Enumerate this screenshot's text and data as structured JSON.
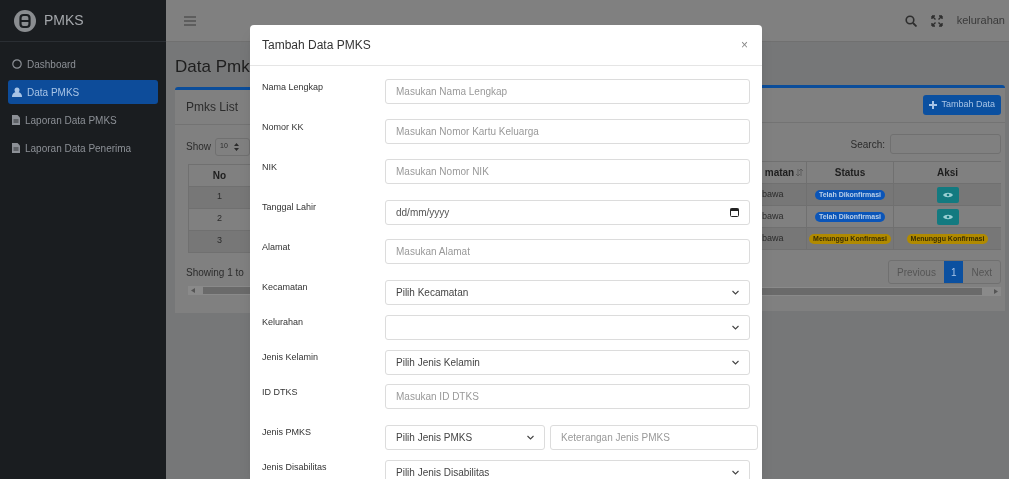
{
  "app": {
    "name": "PMKS"
  },
  "sidebar": {
    "items": [
      {
        "label": "Dashboard",
        "kind": "circle",
        "selected": false
      },
      {
        "label": "Data PMKS",
        "kind": "user",
        "selected": true
      },
      {
        "label": "Laporan Data PMKS",
        "kind": "file",
        "selected": false
      },
      {
        "label": "Laporan Data Penerima",
        "kind": "file",
        "selected": false
      }
    ]
  },
  "navbar": {
    "user": "kelurahan"
  },
  "page": {
    "title": "Data Pmk"
  },
  "card": {
    "title": "Pmks List",
    "add_button": "Tambah Data",
    "show_label": "Show",
    "page_size": "10",
    "search_label": "Search:"
  },
  "table": {
    "columns": [
      "No",
      "matan",
      "Status",
      "Aksi"
    ],
    "rows": [
      {
        "no": "1",
        "column_2": "bawa",
        "status": {
          "label": "Telah Dikonfirmasi",
          "kind": "confirmed"
        },
        "action": {
          "kind": "view"
        }
      },
      {
        "no": "2",
        "column_2": "bawa",
        "status": {
          "label": "Telah Dikonfirmasi",
          "kind": "confirmed"
        },
        "action": {
          "kind": "view"
        }
      },
      {
        "no": "3",
        "column_2": "bawa",
        "status": {
          "label": "Menunggu Konfirmasi",
          "kind": "waiting"
        },
        "action": {
          "kind": "badge",
          "label": "Menunggu Konfirmasi"
        }
      }
    ]
  },
  "footer": {
    "info": "Showing 1 to",
    "pagination": [
      {
        "label": "Previous",
        "selected": false
      },
      {
        "label": "1",
        "selected": true
      },
      {
        "label": "Next",
        "selected": false
      }
    ]
  },
  "modal": {
    "title": "Tambah Data PMKS",
    "close": "×",
    "fields": [
      {
        "label": "Nama Lengkap",
        "kind": "text",
        "placeholder": "Masukan Nama Lengkap"
      },
      {
        "label": "Nomor KK",
        "kind": "text",
        "placeholder": "Masukan Nomor Kartu Keluarga"
      },
      {
        "label": "NIK",
        "kind": "text",
        "placeholder": "Masukan Nomor NIK"
      },
      {
        "label": "Tanggal Lahir",
        "kind": "date",
        "placeholder": "dd/mm/yyyy"
      },
      {
        "label": "Alamat",
        "kind": "text",
        "placeholder": "Masukan Alamat"
      },
      {
        "label": "Kecamatan",
        "kind": "select",
        "value": "Pilih Kecamatan"
      },
      {
        "label": "Kelurahan",
        "kind": "select"
      },
      {
        "label": "Jenis Kelamin",
        "kind": "select",
        "value": "Pilih Jenis Kelamin"
      },
      {
        "label": "ID DTKS",
        "kind": "text",
        "placeholder": "Masukan ID DTKS"
      },
      {
        "label": "Jenis PMKS",
        "kind": "select_text",
        "value": "Pilih Jenis PMKS",
        "placeholder": "Keterangan Jenis PMKS"
      },
      {
        "label": "Jenis Disabilitas",
        "kind": "select",
        "value": "Pilih Jenis Disabilitas"
      }
    ]
  }
}
